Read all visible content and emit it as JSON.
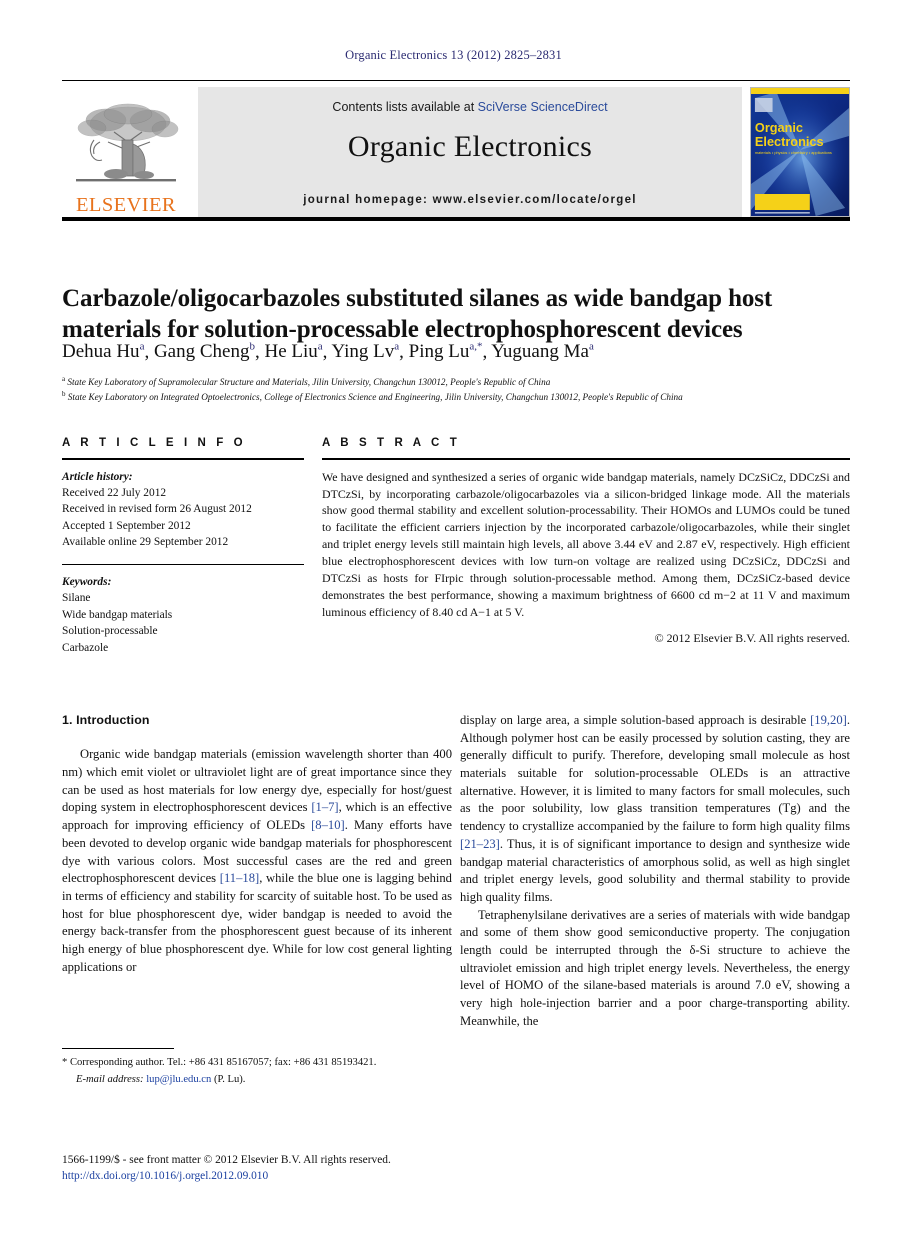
{
  "running_head": "Organic Electronics 13 (2012) 2825–2831",
  "masthead": {
    "publisher_wordmark": "ELSEVIER",
    "contents_prefix": "Contents lists available at ",
    "contents_link": "SciVerse ScienceDirect",
    "journal_name": "Organic Electronics",
    "homepage": "journal homepage: www.elsevier.com/locate/orgel",
    "cover": {
      "title_line1": "Organic",
      "title_line2": "Electronics",
      "subtitle": "materials • physics • chemistry • applications"
    }
  },
  "article": {
    "title": "Carbazole/oligocarbazoles substituted silanes as wide bandgap host materials for solution-processable electrophosphorescent devices",
    "authors": [
      {
        "name": "Dehua Hu",
        "sup": "a",
        "sep": ","
      },
      {
        "name": "Gang Cheng",
        "sup": "b",
        "sep": ","
      },
      {
        "name": "He Liu",
        "sup": "a",
        "sep": ","
      },
      {
        "name": "Ying Lv",
        "sup": "a",
        "sep": ","
      },
      {
        "name": "Ping Lu",
        "sup": "a,*",
        "sep": ","
      },
      {
        "name": "Yuguang Ma",
        "sup": "a",
        "sep": ""
      }
    ],
    "affiliations": [
      {
        "marker": "a",
        "text": "State Key Laboratory of Supramolecular Structure and Materials, Jilin University, Changchun 130012, People's Republic of China"
      },
      {
        "marker": "b",
        "text": "State Key Laboratory on Integrated Optoelectronics, College of Electronics Science and Engineering, Jilin University, Changchun 130012, People's Republic of China"
      }
    ]
  },
  "article_info": {
    "heading": "A R T I C L E   I N F O",
    "history_label": "Article history:",
    "history": [
      "Received 22 July 2012",
      "Received in revised form 26 August 2012",
      "Accepted 1 September 2012",
      "Available online 29 September 2012"
    ],
    "keywords_label": "Keywords:",
    "keywords": [
      "Silane",
      "Wide bandgap materials",
      "Solution-processable",
      "Carbazole"
    ]
  },
  "abstract": {
    "heading": "A B S T R A C T",
    "text": "We have designed and synthesized a series of organic wide bandgap materials, namely DCzSiCz, DDCzSi and DTCzSi, by incorporating carbazole/oligocarbazoles via a silicon-bridged linkage mode. All the materials show good thermal stability and excellent solution-processability. Their HOMOs and LUMOs could be tuned to facilitate the efficient carriers injection by the incorporated carbazole/oligocarbazoles, while their singlet and triplet energy levels still maintain high levels, all above 3.44 eV and 2.87 eV, respectively. High efficient blue electrophosphorescent devices with low turn-on voltage are realized using DCzSiCz, DDCzSi and DTCzSi as hosts for FIrpic through solution-processable method. Among them, DCzSiCz-based device demonstrates the best performance, showing a maximum brightness of 6600 cd m−2 at 11 V and maximum luminous efficiency of 8.40 cd A−1 at 5 V.",
    "copyright": "© 2012 Elsevier B.V. All rights reserved."
  },
  "body": {
    "section_heading": "1. Introduction",
    "left_paragraph_1_a": "Organic wide bandgap materials (emission wavelength shorter than 400 nm) which emit violet or ultraviolet light are of great importance since they can be used as host materials for low energy dye, especially for host/guest doping system in electrophosphorescent devices ",
    "ref_1_7": "[1–7]",
    "left_paragraph_1_b": ", which is an effective approach for improving efficiency of OLEDs ",
    "ref_8_10": "[8–10]",
    "left_paragraph_1_c": ". Many efforts have been devoted to develop organic wide bandgap materials for phosphorescent dye with various colors. Most successful cases are the red and green electrophosphorescent devices ",
    "ref_11_18": "[11–18]",
    "left_paragraph_1_d": ", while the blue one is lagging behind in terms of efficiency and stability for scarcity of suitable host. To be used as host for blue phosphorescent dye, wider bandgap is needed to avoid the energy back-transfer from the phosphorescent guest because of its inherent high energy of blue phosphorescent dye. While for low cost general lighting applications or",
    "right_paragraph_1_a": "display on large area, a simple solution-based approach is desirable ",
    "ref_19_20": "[19,20]",
    "right_paragraph_1_b": ". Although polymer host can be easily processed by solution casting, they are generally difficult to purify. Therefore, developing small molecule as host materials suitable for solution-processable OLEDs is an attractive alternative. However, it is limited to many factors for small molecules, such as the poor solubility, low glass transition temperatures (Tg) and the tendency to crystallize accompanied by the failure to form high quality films ",
    "ref_21_23": "[21–23]",
    "right_paragraph_1_c": ". Thus, it is of significant importance to design and synthesize wide bandgap material characteristics of amorphous solid, as well as high singlet and triplet energy levels, good solubility and thermal stability to provide high quality films.",
    "right_paragraph_2": "Tetraphenylsilane derivatives are a series of materials with wide bandgap and some of them show good semiconductive property. The conjugation length could be interrupted through the δ-Si structure to achieve the ultraviolet emission and high triplet energy levels. Nevertheless, the energy level of HOMO of the silane-based materials is around 7.0 eV, showing a very high hole-injection barrier and a poor charge-transporting ability. Meanwhile, the"
  },
  "footnote": {
    "corresponding": "* Corresponding author. Tel.: +86 431 85167057; fax: +86 431 85193421.",
    "email_label": "E-mail address:",
    "email": "lup@jlu.edu.cn",
    "email_owner": "(P. Lu)."
  },
  "footer": {
    "issn_line": "1566-1199/$ - see front matter © 2012 Elsevier B.V. All rights reserved.",
    "doi": "http://dx.doi.org/10.1016/j.orgel.2012.09.010"
  },
  "colors": {
    "link_blue": "#2b4b9b",
    "elsevier_orange": "#e8731d",
    "running_head_blue": "#2b2b72",
    "masthead_grey": "#e6e6e6",
    "cover_blue": "#0a1c6b",
    "cover_yellow": "#f5d118"
  }
}
